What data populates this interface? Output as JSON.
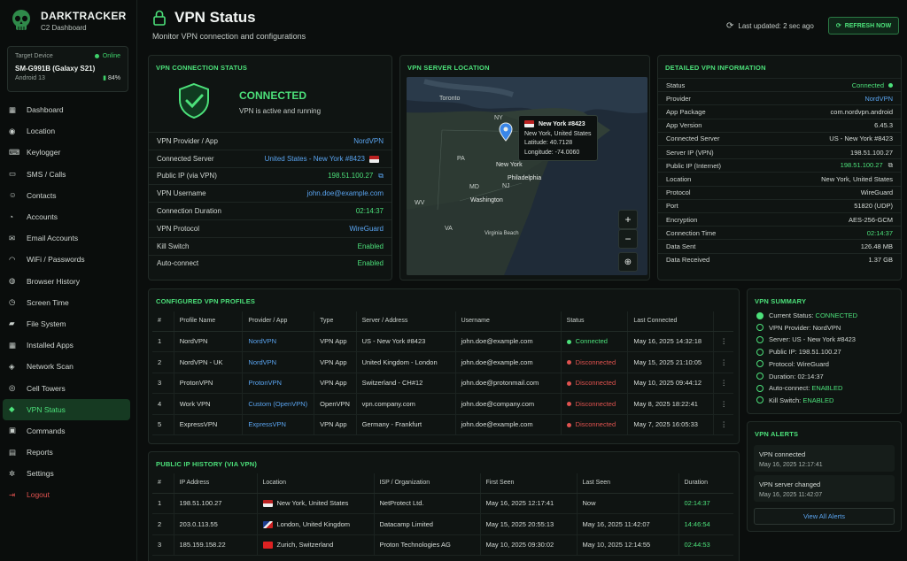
{
  "brand": {
    "title": "DARKTRACKER",
    "subtitle": "C2 Dashboard"
  },
  "device": {
    "label": "Target Device",
    "status": "Online",
    "name": "SM-G991B (Galaxy S21)",
    "os": "Android 13",
    "battery": "84%"
  },
  "nav": [
    {
      "label": "Dashboard",
      "icon": "dashboard-icon"
    },
    {
      "label": "Location",
      "icon": "location-pin-icon"
    },
    {
      "label": "Keylogger",
      "icon": "keyboard-icon"
    },
    {
      "label": "SMS / Calls",
      "icon": "chat-icon"
    },
    {
      "label": "Contacts",
      "icon": "contacts-icon"
    },
    {
      "label": "Accounts",
      "icon": "user-icon"
    },
    {
      "label": "Email Accounts",
      "icon": "mail-icon"
    },
    {
      "label": "WiFi / Passwords",
      "icon": "wifi-icon"
    },
    {
      "label": "Browser History",
      "icon": "globe-icon"
    },
    {
      "label": "Screen Time",
      "icon": "clock-icon"
    },
    {
      "label": "File System",
      "icon": "folder-icon"
    },
    {
      "label": "Installed Apps",
      "icon": "apps-grid-icon"
    },
    {
      "label": "Network Scan",
      "icon": "network-icon"
    },
    {
      "label": "Cell Towers",
      "icon": "tower-icon"
    },
    {
      "label": "VPN Status",
      "icon": "shield-icon"
    },
    {
      "label": "Commands",
      "icon": "terminal-icon"
    },
    {
      "label": "Reports",
      "icon": "report-icon"
    },
    {
      "label": "Settings",
      "icon": "gear-icon"
    },
    {
      "label": "Logout",
      "icon": "logout-icon"
    }
  ],
  "header": {
    "title": "VPN Status",
    "subtitle": "Monitor VPN connection and configurations",
    "updated": "Last updated: 2 sec ago",
    "refresh": "REFRESH NOW"
  },
  "connection": {
    "title": "VPN CONNECTION STATUS",
    "state": "CONNECTED",
    "state_sub": "VPN is active and running",
    "rows": [
      {
        "k": "VPN Provider / App",
        "v": "NordVPN"
      },
      {
        "k": "Connected Server",
        "v": "United States - New York #8423"
      },
      {
        "k": "Public IP (via VPN)",
        "v": "198.51.100.27"
      },
      {
        "k": "VPN Username",
        "v": "john.doe@example.com"
      },
      {
        "k": "Connection Duration",
        "v": "02:14:37"
      },
      {
        "k": "VPN Protocol",
        "v": "WireGuard"
      },
      {
        "k": "Kill Switch",
        "v": "Enabled"
      },
      {
        "k": "Auto-connect",
        "v": "Enabled"
      }
    ]
  },
  "map": {
    "title": "VPN SERVER LOCATION",
    "labels": [
      "Toronto",
      "NY",
      "PA",
      "New York",
      "Philadelphia",
      "MD",
      "NJ",
      "Washington",
      "WV",
      "VA",
      "Virginia Beach"
    ],
    "popup": {
      "name": "New York #8423",
      "city": "New York, United States",
      "lat": "Latitude: 40.7128",
      "lon": "Longitude: -74.0060"
    },
    "zoom_in": "+",
    "zoom_out": "−"
  },
  "detail": {
    "title": "DETAILED VPN INFORMATION",
    "rows": [
      {
        "k": "Status",
        "v": "Connected"
      },
      {
        "k": "Provider",
        "v": "NordVPN"
      },
      {
        "k": "App Package",
        "v": "com.nordvpn.android"
      },
      {
        "k": "App Version",
        "v": "6.45.3"
      },
      {
        "k": "Connected Server",
        "v": "US - New York #8423"
      },
      {
        "k": "Server IP (VPN)",
        "v": "198.51.100.27"
      },
      {
        "k": "Public IP (Internet)",
        "v": "198.51.100.27"
      },
      {
        "k": "Location",
        "v": "New York, United States"
      },
      {
        "k": "Protocol",
        "v": "WireGuard"
      },
      {
        "k": "Port",
        "v": "51820 (UDP)"
      },
      {
        "k": "Encryption",
        "v": "AES-256-GCM"
      },
      {
        "k": "Connection Time",
        "v": "02:14:37"
      },
      {
        "k": "Data Sent",
        "v": "126.48 MB"
      },
      {
        "k": "Data Received",
        "v": "1.37 GB"
      }
    ]
  },
  "profiles": {
    "title": "CONFIGURED VPN PROFILES",
    "headers": [
      "#",
      "Profile Name",
      "Provider / App",
      "Type",
      "Server / Address",
      "Username",
      "Status",
      "Last Connected",
      ""
    ],
    "rows": [
      {
        "n": "1",
        "name": "NordVPN",
        "provider": "NordVPN",
        "type": "VPN App",
        "server": "US - New York #8423",
        "user": "john.doe@example.com",
        "status": "Connected",
        "last": "May 16, 2025 14:32:18"
      },
      {
        "n": "2",
        "name": "NordVPN - UK",
        "provider": "NordVPN",
        "type": "VPN App",
        "server": "United Kingdom - London",
        "user": "john.doe@example.com",
        "status": "Disconnected",
        "last": "May 15, 2025 21:10:05"
      },
      {
        "n": "3",
        "name": "ProtonVPN",
        "provider": "ProtonVPN",
        "type": "VPN App",
        "server": "Switzerland - CH#12",
        "user": "john.doe@protonmail.com",
        "status": "Disconnected",
        "last": "May 10, 2025 09:44:12"
      },
      {
        "n": "4",
        "name": "Work VPN",
        "provider": "Custom (OpenVPN)",
        "type": "OpenVPN",
        "server": "vpn.company.com",
        "user": "john.doe@company.com",
        "status": "Disconnected",
        "last": "May 8, 2025 18:22:41"
      },
      {
        "n": "5",
        "name": "ExpressVPN",
        "provider": "ExpressVPN",
        "type": "VPN App",
        "server": "Germany - Frankfurt",
        "user": "john.doe@example.com",
        "status": "Disconnected",
        "last": "May 7, 2025 16:05:33"
      }
    ]
  },
  "history": {
    "title": "PUBLIC IP HISTORY (VIA VPN)",
    "headers": [
      "#",
      "IP Address",
      "Location",
      "ISP / Organization",
      "First Seen",
      "Last Seen",
      "Duration"
    ],
    "rows": [
      {
        "n": "1",
        "ip": "198.51.100.27",
        "loc": "New York, United States",
        "isp": "NetProtect Ltd.",
        "first": "May 16, 2025 12:17:41",
        "last": "Now",
        "dur": "02:14:37"
      },
      {
        "n": "2",
        "ip": "203.0.113.55",
        "loc": "London, United Kingdom",
        "isp": "Datacamp Limited",
        "first": "May 15, 2025 20:55:13",
        "last": "May 16, 2025 11:42:07",
        "dur": "14:46:54"
      },
      {
        "n": "3",
        "ip": "185.159.158.22",
        "loc": "Zurich, Switzerland",
        "isp": "Proton Technologies AG",
        "first": "May 10, 2025 09:30:02",
        "last": "May 10, 2025 12:14:55",
        "dur": "02:44:53"
      }
    ]
  },
  "summary": {
    "title": "VPN SUMMARY",
    "items": [
      {
        "label": "Current Status: ",
        "value": "CONNECTED"
      },
      {
        "label": "VPN Provider: NordVPN",
        "value": ""
      },
      {
        "label": "Server: US - New York #8423",
        "value": ""
      },
      {
        "label": "Public IP: 198.51.100.27",
        "value": ""
      },
      {
        "label": "Protocol: WireGuard",
        "value": ""
      },
      {
        "label": "Duration: 02:14:37",
        "value": ""
      },
      {
        "label": "Auto-connect: ",
        "value": "ENABLED"
      },
      {
        "label": "Kill Switch: ",
        "value": "ENABLED"
      }
    ]
  },
  "alerts": {
    "title": "VPN ALERTS",
    "items": [
      {
        "text": "VPN connected",
        "time": "May 16, 2025 12:17:41"
      },
      {
        "text": "VPN server changed",
        "time": "May 16, 2025 11:42:07"
      }
    ],
    "view_all": "View All Alerts"
  },
  "colors": {
    "accent": "#4ce07a",
    "link": "#5aa4f0",
    "danger": "#e0524f",
    "bg": "#0b0e0d"
  }
}
